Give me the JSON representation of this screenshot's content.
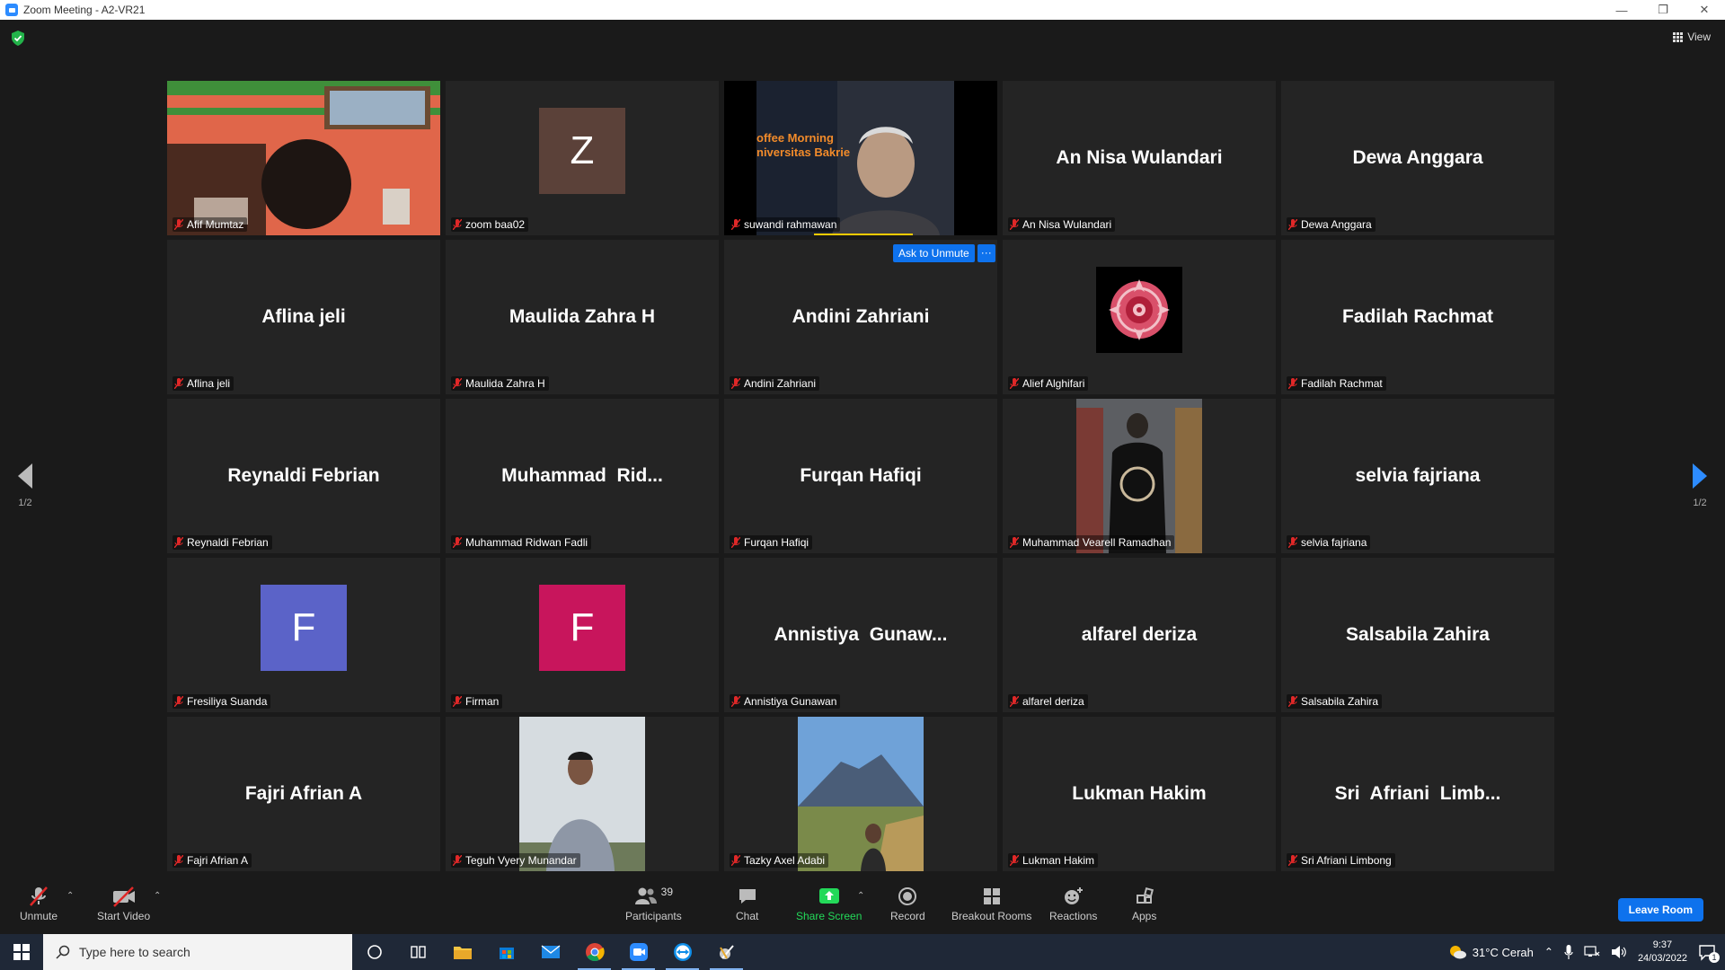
{
  "window": {
    "title": "Zoom Meeting - A2-VR21",
    "min": "—",
    "restore": "❐",
    "close": "✕"
  },
  "view_label": "View",
  "pager": {
    "left": "1/2",
    "right": "1/2"
  },
  "ask_to_unmute": {
    "label": "Ask to Unmute",
    "more": "···"
  },
  "tiles": [
    {
      "label": "Afif Mumtaz",
      "big": "",
      "type": "video-room",
      "active": true
    },
    {
      "label": "zoom baa02",
      "big": "",
      "type": "avatar",
      "letter": "Z",
      "color": "#5b4139"
    },
    {
      "label": "suwandi rahmawan",
      "big": "",
      "type": "video-speaker",
      "slide_text": "offee Morning\nniversitas Bakrie"
    },
    {
      "label": "An Nisa Wulandari",
      "big": "An Nisa Wulandari",
      "type": "name"
    },
    {
      "label": "Dewa Anggara",
      "big": "Dewa Anggara",
      "type": "name"
    },
    {
      "label": "Aflina jeli",
      "big": "Aflina jeli",
      "type": "name"
    },
    {
      "label": "Maulida Zahra H",
      "big": "Maulida Zahra H",
      "type": "name"
    },
    {
      "label": "Andini Zahriani",
      "big": "Andini Zahriani",
      "type": "name"
    },
    {
      "label": "Alief Alghifari",
      "big": "",
      "type": "mandala"
    },
    {
      "label": "Fadilah Rachmat",
      "big": "Fadilah Rachmat",
      "type": "name"
    },
    {
      "label": "Reynaldi Febrian",
      "big": "Reynaldi Febrian",
      "type": "name"
    },
    {
      "label": "Muhammad Ridwan Fadli",
      "big": "Muhammad  Rid...",
      "type": "name"
    },
    {
      "label": "Furqan Hafiqi",
      "big": "Furqan Hafiqi",
      "type": "name"
    },
    {
      "label": "Muhammad Vearell Ramadhan",
      "big": "",
      "type": "photo-store"
    },
    {
      "label": "selvia fajriana",
      "big": "selvia fajriana",
      "type": "name"
    },
    {
      "label": "Fresiliya Suanda",
      "big": "",
      "type": "avatar",
      "letter": "F",
      "color": "#5b63c8"
    },
    {
      "label": "Firman",
      "big": "",
      "type": "avatar",
      "letter": "F",
      "color": "#c8155c"
    },
    {
      "label": "Annistiya Gunawan",
      "big": "Annistiya  Gunaw...",
      "type": "name"
    },
    {
      "label": "alfarel deriza",
      "big": "alfarel deriza",
      "type": "name"
    },
    {
      "label": "Salsabila Zahira",
      "big": "Salsabila Zahira",
      "type": "name"
    },
    {
      "label": "Fajri Afrian A",
      "big": "Fajri Afrian A",
      "type": "name"
    },
    {
      "label": "Teguh Vyery Munandar",
      "big": "",
      "type": "photo-portrait"
    },
    {
      "label": "Tazky Axel Adabi",
      "big": "",
      "type": "photo-mountain"
    },
    {
      "label": "Lukman Hakim",
      "big": "Lukman Hakim",
      "type": "name"
    },
    {
      "label": "Sri Afriani Limbong",
      "big": "Sri  Afriani  Limb...",
      "type": "name"
    }
  ],
  "toolbar": {
    "unmute": "Unmute",
    "start_video": "Start Video",
    "participants": "Participants",
    "participants_count": "39",
    "chat": "Chat",
    "share_screen": "Share Screen",
    "record": "Record",
    "breakout_rooms": "Breakout Rooms",
    "reactions": "Reactions",
    "apps": "Apps",
    "leave": "Leave Room"
  },
  "taskbar": {
    "search_placeholder": "Type here to search",
    "weather": "31°C  Cerah",
    "time": "9:37",
    "date": "24/03/2022",
    "notif_count": "1"
  },
  "colors": {
    "accent": "#0e72ed",
    "active_speaker": "#f0e868",
    "share_green": "#23d959",
    "muted_red": "#e02828"
  }
}
